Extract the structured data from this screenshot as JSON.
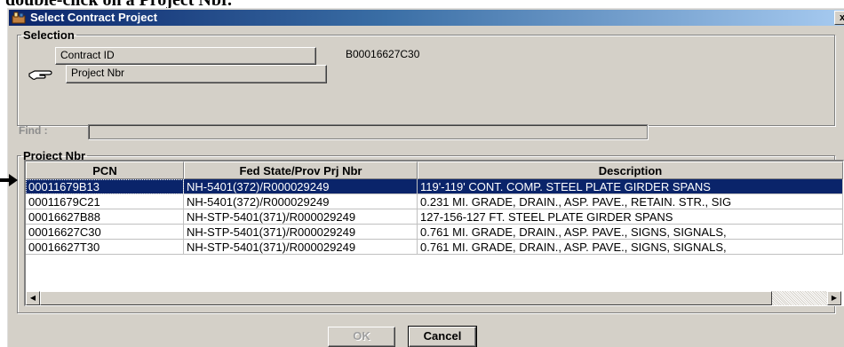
{
  "document": {
    "caption_fragment": "double-click on a Project Nbr."
  },
  "window": {
    "title": "Select Contract Project",
    "close_label": "x"
  },
  "selection": {
    "legend": "Selection",
    "contract_id_label": "Contract ID",
    "contract_id_value": "B00016627C30",
    "project_nbr_label": "Project Nbr"
  },
  "find": {
    "label": "Find :",
    "value": ""
  },
  "project_nbr": {
    "legend": "Project Nbr",
    "columns": [
      "PCN",
      "Fed State/Prov Prj Nbr",
      "Description"
    ],
    "rows": [
      {
        "pcn": "00011679B13",
        "fed": "NH-5401(372)/R000029249",
        "desc": "119'-119' CONT. COMP. STEEL PLATE GIRDER SPANS"
      },
      {
        "pcn": "00011679C21",
        "fed": "NH-5401(372)/R000029249",
        "desc": "0.231 MI. GRADE, DRAIN., ASP. PAVE., RETAIN. STR., SIG"
      },
      {
        "pcn": "00016627B88",
        "fed": "NH-STP-5401(371)/R000029249",
        "desc": "127-156-127 FT. STEEL PLATE GIRDER SPANS"
      },
      {
        "pcn": "00016627C30",
        "fed": "NH-STP-5401(371)/R000029249",
        "desc": "0.761 MI. GRADE, DRAIN., ASP. PAVE., SIGNS, SIGNALS,"
      },
      {
        "pcn": "00016627T30",
        "fed": "NH-STP-5401(371)/R000029249",
        "desc": "0.761 MI. GRADE, DRAIN., ASP. PAVE., SIGNS, SIGNALS,"
      }
    ],
    "selected_row": 0
  },
  "buttons": {
    "ok": "OK",
    "cancel": "Cancel"
  },
  "icons": {
    "title": "app-icon",
    "pointer": "pointing-hand-icon",
    "arrow": "right-arrow-icon",
    "scroll_left": "scroll-left-icon",
    "scroll_right": "scroll-right-icon"
  },
  "colors": {
    "title_bar": "#0a246a",
    "selection": "#0a246a",
    "face": "#d4d0c8"
  }
}
